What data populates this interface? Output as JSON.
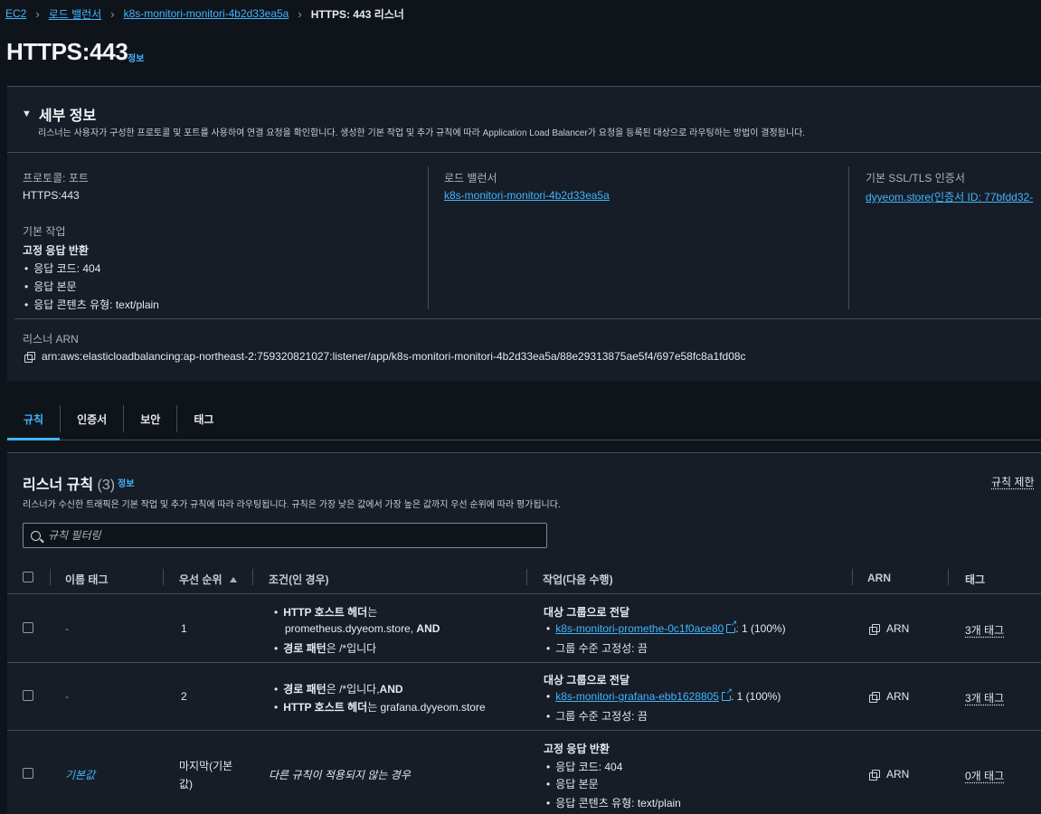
{
  "breadcrumb": {
    "ec2": "EC2",
    "load_balancers": "로드 밸런서",
    "lb_name": "k8s-monitori-monitori-4b2d33ea5a",
    "current": "HTTPS: 443 리스너"
  },
  "page": {
    "title": "HTTPS:443",
    "info": "정보"
  },
  "details": {
    "heading": "세부 정보",
    "description": "리스너는 사용자가 구성한 프로토콜 및 포트를 사용하여 연결 요청을 확인합니다. 생성한 기본 작업 및 추가 규칙에 따라 Application Load Balancer가 요청을 등록된 대상으로 라우팅하는 방법이 결정됩니다.",
    "protocol_port_label": "프로토콜: 포트",
    "protocol_port_value": "HTTPS:443",
    "load_balancer_label": "로드 밸런서",
    "load_balancer_value": "k8s-monitori-monitori-4b2d33ea5a",
    "ssl_label": "기본 SSL/TLS 인증서",
    "ssl_value": "dyyeom.store(인증서 ID: 77bfdd32-",
    "default_action_label": "기본 작업",
    "default_action_title": "고정 응답 반환",
    "default_action_items": [
      "응답 코드: 404",
      "응답 본문",
      "응답 콘텐츠 유형: text/plain"
    ],
    "arn_label": "리스너 ARN",
    "arn_value": "arn:aws:elasticloadbalancing:ap-northeast-2:759320821027:listener/app/k8s-monitori-monitori-4b2d33ea5a/88e29313875ae5f4/697e58fc8a1fd08c"
  },
  "tabs": [
    "규칙",
    "인증서",
    "보안",
    "태그"
  ],
  "rules": {
    "title": "리스너 규칙",
    "count": "(3)",
    "info": "정보",
    "limit": "규칙 제한",
    "description": "리스너가 수신한 트래픽은 기본 작업 및 추가 규칙에 따라 라우팅됩니다. 규칙은 가장 낮은 값에서 가장 높은 값까지 우선 순위에 따라 평가됩니다.",
    "search_placeholder": "규칙 필터링",
    "columns": {
      "name_tag": "이름 태그",
      "priority": "우선 순위",
      "conditions": "조건(인 경우)",
      "actions": "작업(다음 수행)",
      "arn": "ARN",
      "tags": "태그"
    },
    "rows": [
      {
        "name": "-",
        "priority": "1",
        "cond1_bold": "HTTP 호스트 헤더",
        "cond1_rest": "는",
        "cond1_line2": "prometheus.dyyeom.store, ",
        "cond1_and": "AND",
        "cond2_bold": "경로 패턴",
        "cond2_rest": "은 /*입니다",
        "action_title": "대상 그룹으로 전달",
        "target": "k8s-monitori-promethe-0c1f0ace80",
        "target_weight": ": 1 (100%)",
        "stickiness": "그룹 수준 고정성: 끔",
        "arn": "ARN",
        "tags": "3개 태그"
      },
      {
        "name": "-",
        "priority": "2",
        "cond1_bold": "경로 패턴",
        "cond1_rest": "은 /*입니다, ",
        "cond1_and": "AND",
        "cond2_bold": "HTTP 호스트 헤더",
        "cond2_rest": "는 grafana.dyyeom.store",
        "action_title": "대상 그룹으로 전달",
        "target": "k8s-monitori-grafana-ebb1628805",
        "target_weight": ": 1 (100%)",
        "stickiness": "그룹 수준 고정성: 끔",
        "arn": "ARN",
        "tags": "3개 태그"
      },
      {
        "name": "기본값",
        "priority_line1": "마지막(기본",
        "priority_line2": "값)",
        "condition": "다른 규칙이 적용되지 않는 경우",
        "action_title": "고정 응답 반환",
        "action_items": [
          "응답 코드: 404",
          "응답 본문",
          "응답 콘텐츠 유형: text/plain"
        ],
        "arn": "ARN",
        "tags": "0개 태그"
      }
    ]
  }
}
